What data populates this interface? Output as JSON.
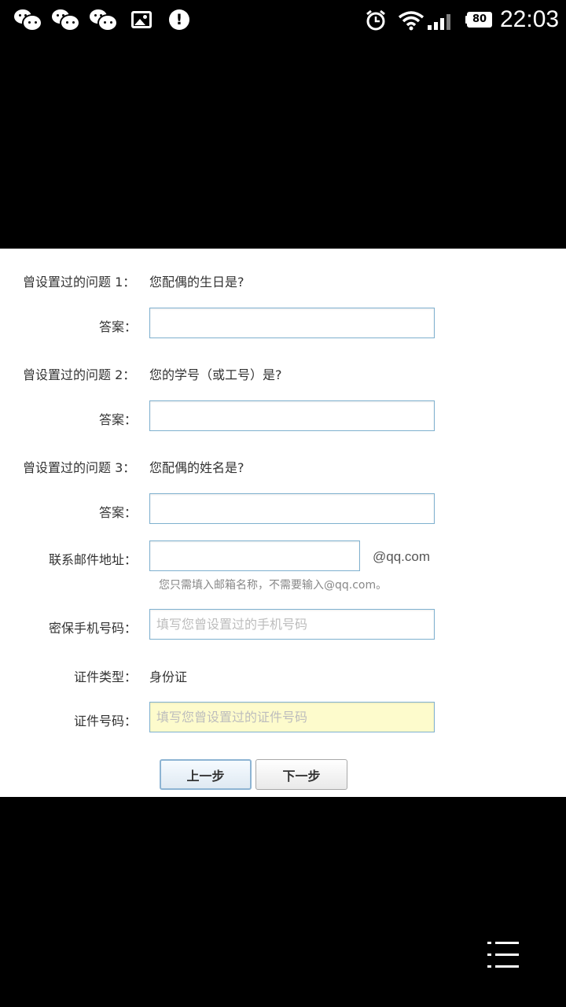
{
  "status_bar": {
    "notification_icons": [
      "wechat-icon",
      "wechat-icon",
      "wechat-icon",
      "gallery-icon",
      "alert-icon"
    ],
    "battery": "80",
    "time": "22:03"
  },
  "form": {
    "questions": [
      {
        "label": "曾设置过的问题 1：",
        "question": "您配偶的生日是?",
        "answer_label": "答案：",
        "answer_value": ""
      },
      {
        "label": "曾设置过的问题 2：",
        "question": "您的学号（或工号）是?",
        "answer_label": "答案：",
        "answer_value": ""
      },
      {
        "label": "曾设置过的问题 3：",
        "question": "您配偶的姓名是?",
        "answer_label": "答案：",
        "answer_value": ""
      }
    ],
    "email": {
      "label": "联系邮件地址：",
      "value": "",
      "domain": "@qq.com",
      "hint": "您只需填入邮箱名称，不需要输入@qq.com。"
    },
    "phone": {
      "label": "密保手机号码：",
      "placeholder": "填写您曾设置过的手机号码"
    },
    "id_type": {
      "label": "证件类型：",
      "value": "身份证"
    },
    "id_number": {
      "label": "证件号码：",
      "placeholder": "填写您曾设置过的证件号码"
    },
    "buttons": {
      "prev": "上一步",
      "next": "下一步"
    }
  },
  "colors": {
    "input_border": "#7fb1cf",
    "highlight_input": "#fdfbcc"
  }
}
